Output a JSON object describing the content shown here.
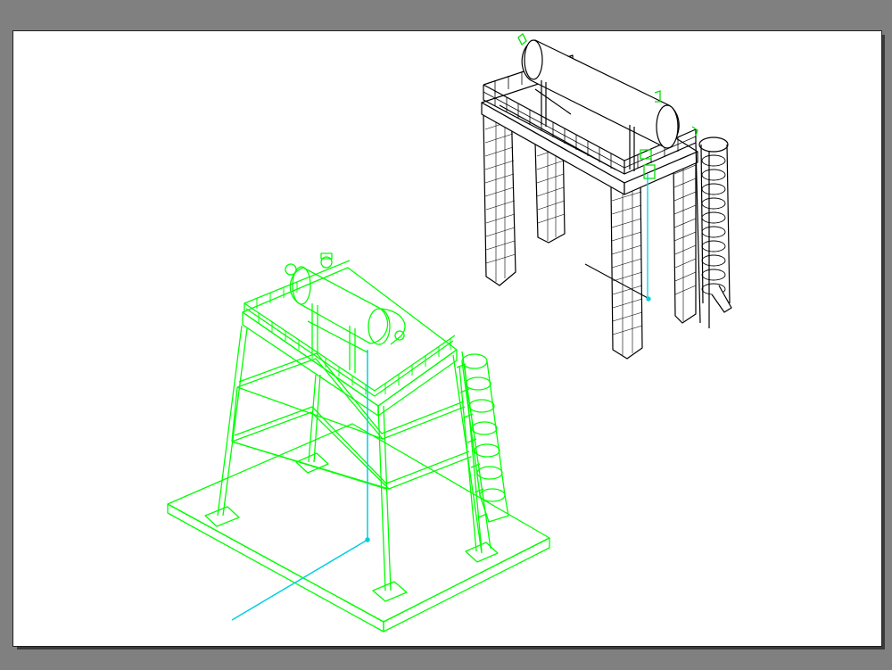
{
  "canvas": {
    "background_color": "#808080",
    "paper_color": "#ffffff"
  },
  "drawing": {
    "views": [
      {
        "id": "wireframe-structure",
        "style": "wireframe",
        "line_color": "#00ff00"
      },
      {
        "id": "rendered-structure",
        "style": "hidden-line",
        "line_color": "#000000"
      }
    ],
    "piping_color": "#00ffff",
    "icons": [
      "tank-icon",
      "ladder-icon",
      "platform-icon",
      "pipe-icon"
    ]
  }
}
